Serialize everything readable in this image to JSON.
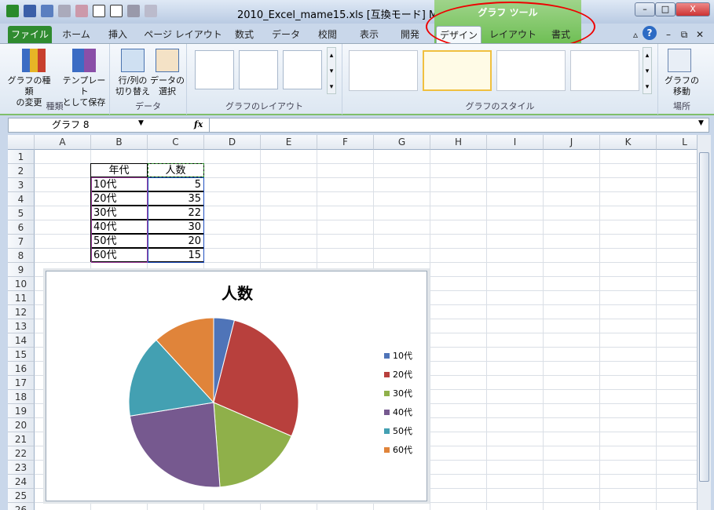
{
  "window": {
    "title": "2010_Excel_mame15.xls  [互換モード] M...",
    "context_tab_group": "グラフ ツール"
  },
  "tabs": [
    "ファイル",
    "ホーム",
    "挿入",
    "ページ レイアウト",
    "数式",
    "データ",
    "校閲",
    "表示",
    "開発",
    "デザイン",
    "レイアウト",
    "書式"
  ],
  "ribbon": {
    "groups": {
      "type": "種類",
      "data": "データ",
      "layout": "グラフのレイアウト",
      "style": "グラフのスタイル",
      "location": "場所"
    },
    "buttons": {
      "change_type": [
        "グラフの種類",
        "の変更"
      ],
      "save_template": [
        "テンプレート",
        "として保存"
      ],
      "switch_row_col": [
        "行/列の",
        "切り替え"
      ],
      "select_data": [
        "データの",
        "選択"
      ],
      "move_chart": [
        "グラフの",
        "移動"
      ]
    }
  },
  "formula_bar": {
    "name_box": "グラフ 8",
    "fx": "fx",
    "value": ""
  },
  "columns": [
    "A",
    "B",
    "C",
    "D",
    "E",
    "F",
    "G",
    "H",
    "I",
    "J",
    "K",
    "L"
  ],
  "rows": [
    "1",
    "2",
    "3",
    "4",
    "5",
    "6",
    "7",
    "8",
    "9",
    "10",
    "11",
    "12",
    "13",
    "14",
    "15",
    "16",
    "17",
    "18",
    "19",
    "20",
    "21",
    "22",
    "23",
    "24",
    "25",
    "26"
  ],
  "table": {
    "headers": [
      "年代",
      "人数"
    ],
    "rows": [
      [
        "10代",
        "5"
      ],
      [
        "20代",
        "35"
      ],
      [
        "30代",
        "22"
      ],
      [
        "40代",
        "30"
      ],
      [
        "50代",
        "20"
      ],
      [
        "60代",
        "15"
      ]
    ]
  },
  "chart": {
    "title": "人数",
    "type": "pie",
    "slices": [
      {
        "label": "10代",
        "value": 5,
        "color": "#4f74b8"
      },
      {
        "label": "20代",
        "value": 35,
        "color": "#b8403d"
      },
      {
        "label": "30代",
        "value": 22,
        "color": "#8fb04a"
      },
      {
        "label": "40代",
        "value": 30,
        "color": "#76598f"
      },
      {
        "label": "50代",
        "value": 20,
        "color": "#43a0b2"
      },
      {
        "label": "60代",
        "value": 15,
        "color": "#e0843a"
      }
    ]
  }
}
